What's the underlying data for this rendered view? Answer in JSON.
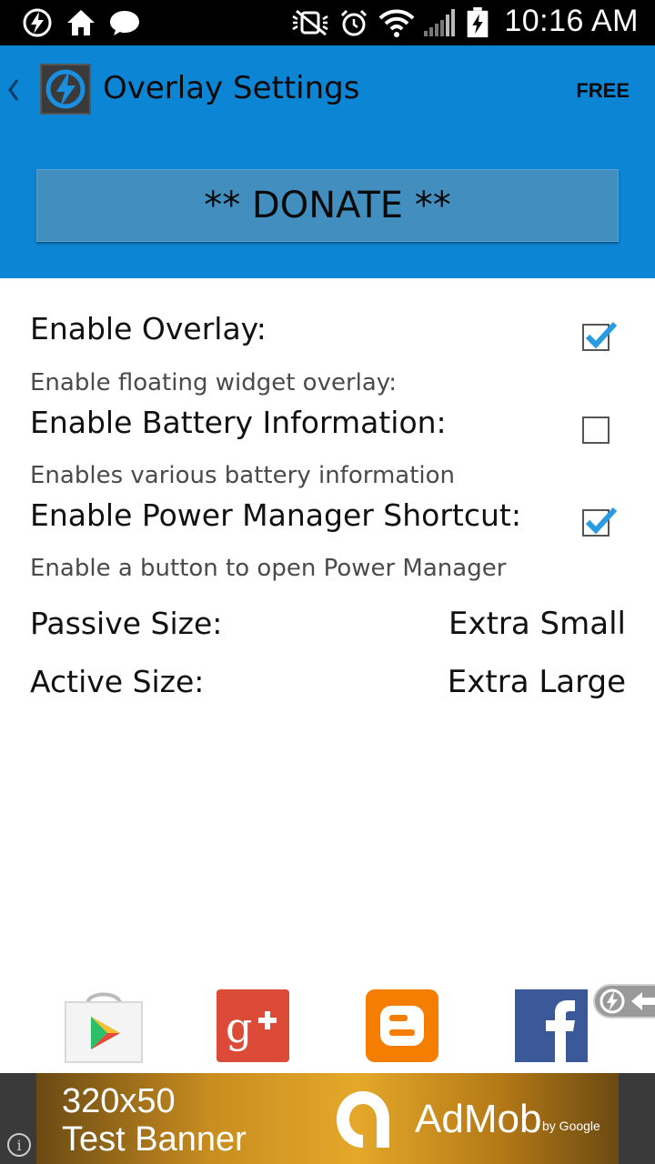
{
  "status_bar": {
    "time": "10:16 AM",
    "icons": [
      "bolt-icon",
      "home-icon",
      "chat-icon",
      "mute-icon",
      "alarm-icon",
      "wifi-icon",
      "signal-icon",
      "battery-charging-icon"
    ]
  },
  "header": {
    "title": "Overlay Settings",
    "badge": "FREE",
    "donate_label": "** DONATE **",
    "accent_color": "#0b85d4"
  },
  "settings": [
    {
      "title": "Enable Overlay:",
      "description": "Enable floating widget overlay:",
      "checked": true
    },
    {
      "title": "Enable Battery Information:",
      "description": "Enables various battery information",
      "checked": false
    },
    {
      "title": "Enable Power Manager Shortcut:",
      "description": "Enable a button to open Power Manager",
      "checked": true
    }
  ],
  "sizes": [
    {
      "label": "Passive Size:",
      "value": "Extra Small"
    },
    {
      "label": "Active Size:",
      "value": "Extra Large"
    }
  ],
  "share": [
    "google-play-icon",
    "google-plus-icon",
    "blogger-icon",
    "facebook-icon"
  ],
  "ad": {
    "line1": "320x50",
    "line2": "Test Banner",
    "brand": "AdMob",
    "by": "by Google"
  }
}
